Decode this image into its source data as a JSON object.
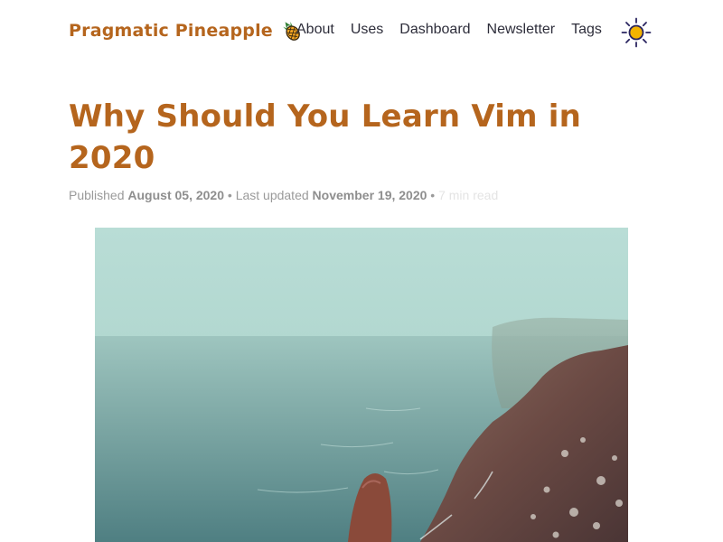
{
  "header": {
    "brand_name": "Pragmatic Pineapple",
    "brand_icon": "pineapple-icon",
    "nav": [
      {
        "label": "About"
      },
      {
        "label": "Uses"
      },
      {
        "label": "Dashboard"
      },
      {
        "label": "Newsletter"
      },
      {
        "label": "Tags"
      }
    ],
    "theme_toggle_icon": "sun-icon"
  },
  "article": {
    "title": "Why Should You Learn Vim in 2020",
    "meta": {
      "published_label": "Published",
      "published_date": "August 05, 2020",
      "separator": "•",
      "updated_label": "Last updated",
      "updated_date": "November 19, 2020",
      "read_time": "7 min read"
    },
    "hero_image_icon": "coastal-cliffs-photo"
  },
  "colors": {
    "brand": "#b5651d",
    "nav_text": "#2d2d3a",
    "meta_text": "#9a9a9a",
    "sun": "#f4b400"
  }
}
